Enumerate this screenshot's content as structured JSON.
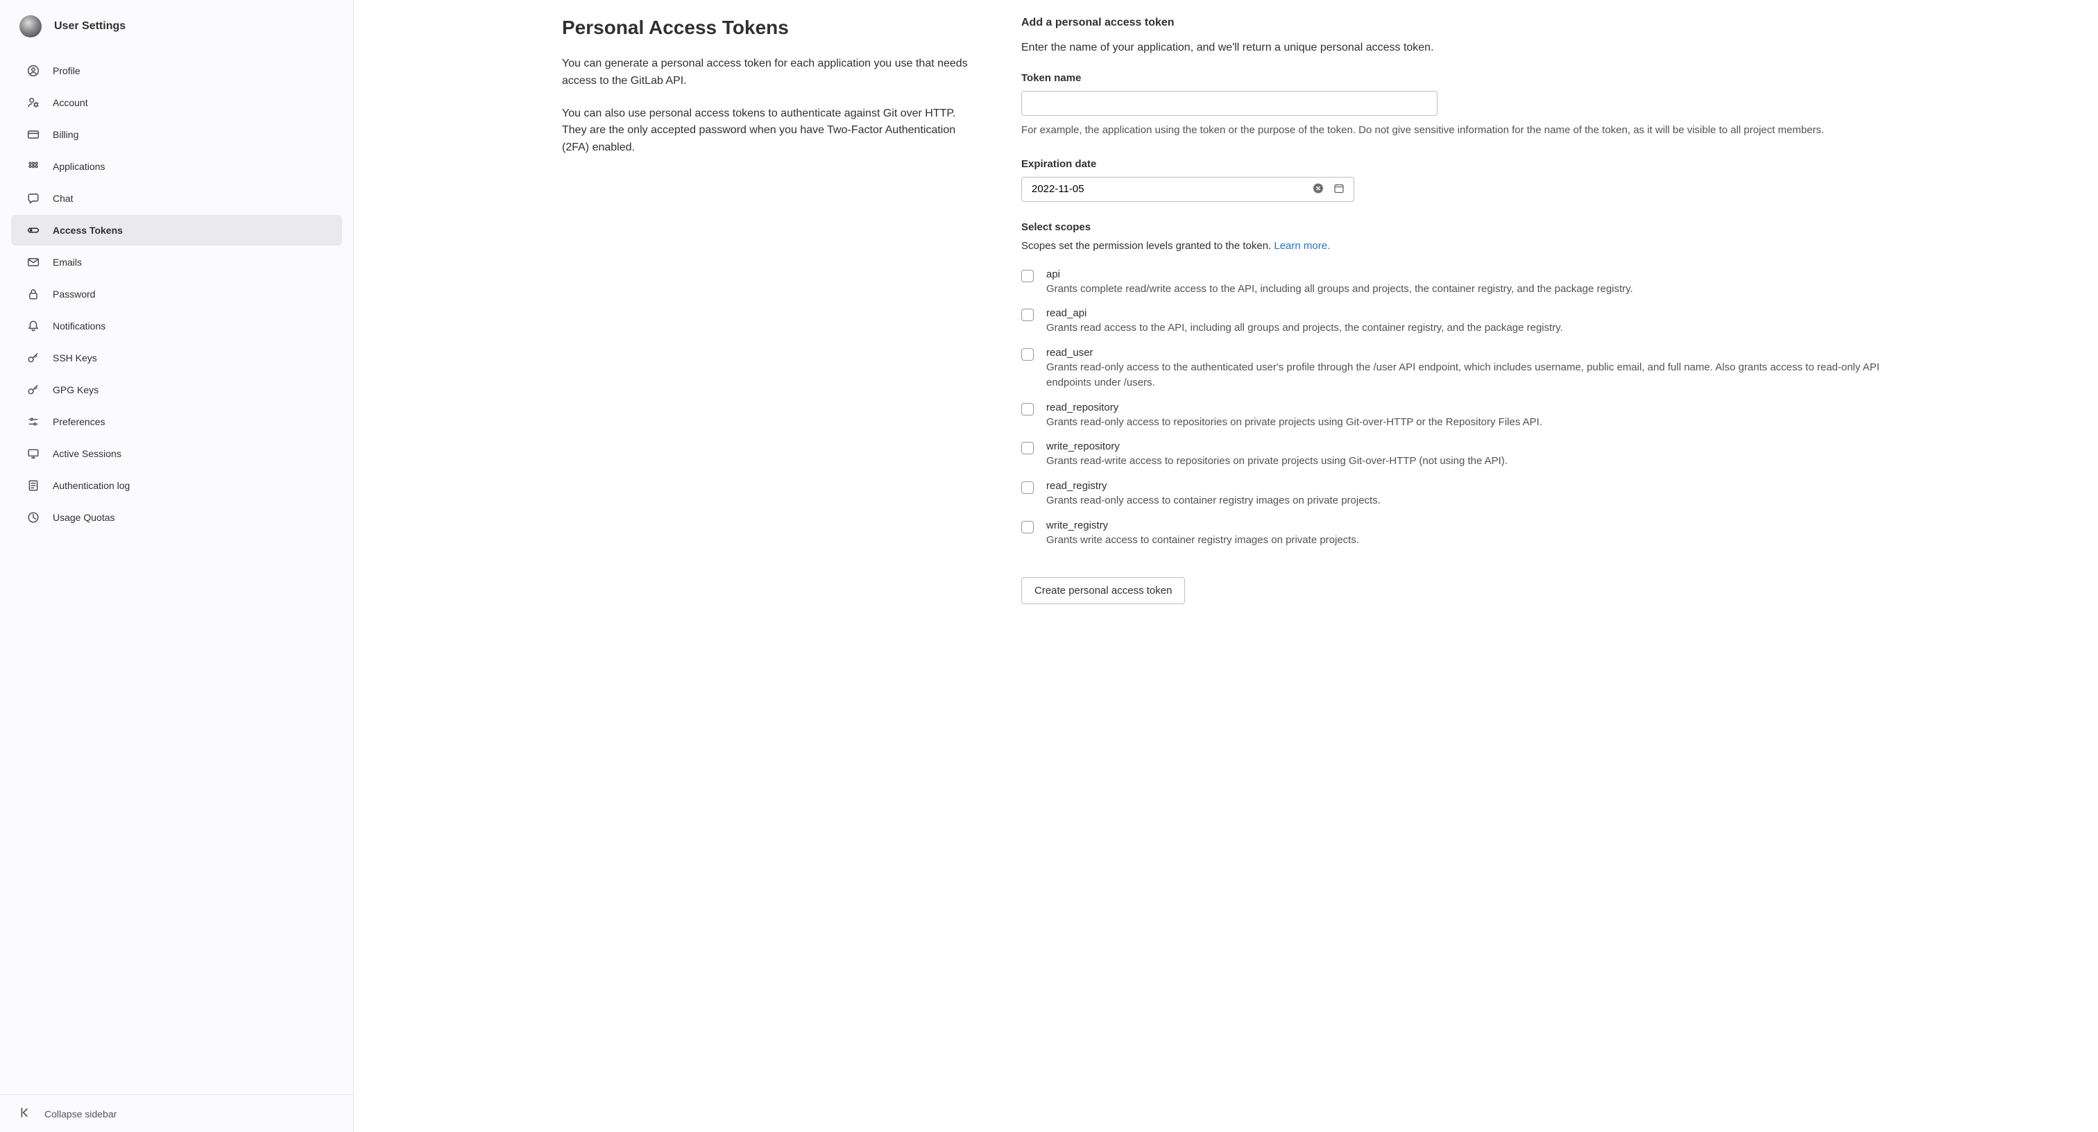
{
  "sidebar": {
    "title": "User Settings",
    "items": [
      {
        "label": "Profile",
        "icon": "user-circle-icon"
      },
      {
        "label": "Account",
        "icon": "account-gear-icon"
      },
      {
        "label": "Billing",
        "icon": "credit-card-icon"
      },
      {
        "label": "Applications",
        "icon": "apps-grid-icon"
      },
      {
        "label": "Chat",
        "icon": "chat-bubble-icon"
      },
      {
        "label": "Access Tokens",
        "icon": "token-icon",
        "active": true
      },
      {
        "label": "Emails",
        "icon": "envelope-icon"
      },
      {
        "label": "Password",
        "icon": "lock-icon"
      },
      {
        "label": "Notifications",
        "icon": "bell-icon"
      },
      {
        "label": "SSH Keys",
        "icon": "key-icon"
      },
      {
        "label": "GPG Keys",
        "icon": "key-icon"
      },
      {
        "label": "Preferences",
        "icon": "sliders-icon"
      },
      {
        "label": "Active Sessions",
        "icon": "monitor-icon"
      },
      {
        "label": "Authentication log",
        "icon": "log-icon"
      },
      {
        "label": "Usage Quotas",
        "icon": "quota-icon"
      }
    ],
    "collapse_label": "Collapse sidebar"
  },
  "left": {
    "heading": "Personal Access Tokens",
    "para1": "You can generate a personal access token for each application you use that needs access to the GitLab API.",
    "para2": "You can also use personal access tokens to authenticate against Git over HTTP. They are the only accepted password when you have Two-Factor Authentication (2FA) enabled."
  },
  "form": {
    "heading": "Add a personal access token",
    "intro": "Enter the name of your application, and we'll return a unique personal access token.",
    "name_label": "Token name",
    "name_value": "",
    "name_help": "For example, the application using the token or the purpose of the token. Do not give sensitive information for the name of the token, as it will be visible to all project members.",
    "exp_label": "Expiration date",
    "exp_value": "2022-11-05",
    "scopes_heading": "Select scopes",
    "scopes_desc": "Scopes set the permission levels granted to the token. ",
    "scopes_link": "Learn more.",
    "submit_label": "Create personal access token",
    "scopes": [
      {
        "name": "api",
        "desc": "Grants complete read/write access to the API, including all groups and projects, the container registry, and the package registry."
      },
      {
        "name": "read_api",
        "desc": "Grants read access to the API, including all groups and projects, the container registry, and the package registry."
      },
      {
        "name": "read_user",
        "desc": "Grants read-only access to the authenticated user's profile through the /user API endpoint, which includes username, public email, and full name. Also grants access to read-only API endpoints under /users."
      },
      {
        "name": "read_repository",
        "desc": "Grants read-only access to repositories on private projects using Git-over-HTTP or the Repository Files API."
      },
      {
        "name": "write_repository",
        "desc": "Grants read-write access to repositories on private projects using Git-over-HTTP (not using the API)."
      },
      {
        "name": "read_registry",
        "desc": "Grants read-only access to container registry images on private projects."
      },
      {
        "name": "write_registry",
        "desc": "Grants write access to container registry images on private projects."
      }
    ]
  }
}
